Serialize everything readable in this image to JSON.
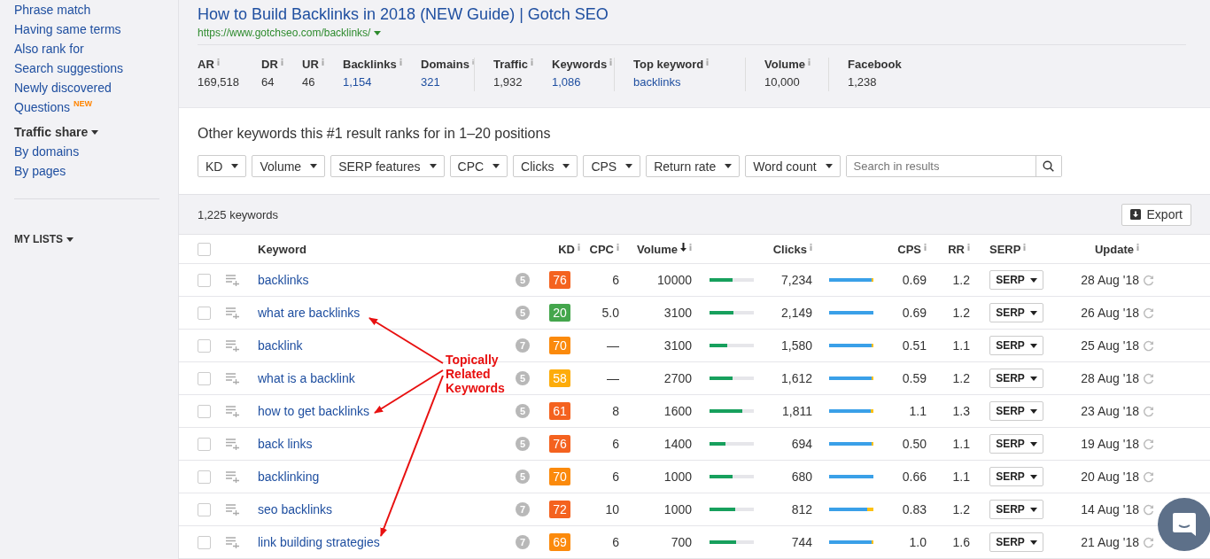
{
  "sidebar": {
    "items": [
      {
        "label": "Phrase match",
        "kind": "link"
      },
      {
        "label": "Having same terms",
        "kind": "link"
      },
      {
        "label": "Also rank for",
        "kind": "link"
      },
      {
        "label": "Search suggestions",
        "kind": "link"
      },
      {
        "label": "Newly discovered",
        "kind": "link"
      },
      {
        "label": "Questions",
        "kind": "link",
        "badge": "NEW"
      },
      {
        "label": "Traffic share",
        "kind": "heading"
      },
      {
        "label": "By domains",
        "kind": "link"
      },
      {
        "label": "By pages",
        "kind": "link"
      },
      {
        "label": "MY LISTS",
        "kind": "section"
      }
    ]
  },
  "page": {
    "title": "How to Build Backlinks in 2018 (NEW Guide) | Gotch SEO",
    "url": "https://www.gotchseo.com/backlinks/",
    "stat_groups": [
      [
        {
          "label": "AR",
          "info": true,
          "value": "169,518",
          "linked": false
        },
        {
          "label": "DR",
          "info": true,
          "value": "64",
          "linked": false
        },
        {
          "label": "UR",
          "info": true,
          "value": "46",
          "linked": false
        },
        {
          "label": "Backlinks",
          "info": true,
          "value": "1,154",
          "linked": true
        },
        {
          "label": "Domains",
          "info": true,
          "value": "321",
          "linked": true
        }
      ],
      [
        {
          "label": "Traffic",
          "info": true,
          "value": "1,932",
          "linked": false
        },
        {
          "label": "Keywords",
          "info": true,
          "value": "1,086",
          "linked": true
        }
      ],
      [
        {
          "label": "Top keyword",
          "info": true,
          "value": "backlinks",
          "linked": true
        }
      ],
      [
        {
          "label": "Volume",
          "info": true,
          "value": "10,000",
          "linked": false
        }
      ],
      [
        {
          "label": "Facebook",
          "info": false,
          "value": "1,238",
          "linked": false
        }
      ]
    ]
  },
  "keywords_panel": {
    "heading": "Other keywords this #1 result ranks for in 1–20 positions",
    "filters": [
      {
        "label": "KD"
      },
      {
        "label": "Volume"
      },
      {
        "label": "SERP features"
      },
      {
        "label": "CPC"
      },
      {
        "label": "Clicks"
      },
      {
        "label": "CPS"
      },
      {
        "label": "Return rate"
      },
      {
        "label": "Word count"
      }
    ],
    "search": {
      "placeholder": "Search in results"
    }
  },
  "results": {
    "count": "1,225 keywords",
    "export": "Export"
  },
  "table": {
    "select_all": {
      "checked": false
    },
    "columns": [
      {
        "label": "Keyword",
        "info": false,
        "sorted": false
      },
      {
        "label": "KD",
        "info": true,
        "sorted": false
      },
      {
        "label": "CPC",
        "info": true,
        "sorted": false
      },
      {
        "label": "Volume",
        "info": true,
        "sorted": true
      },
      {
        "label": "Clicks",
        "info": true,
        "sorted": false
      },
      {
        "label": "CPS",
        "info": true,
        "sorted": false
      },
      {
        "label": "RR",
        "info": true,
        "sorted": false
      },
      {
        "label": "SERP",
        "info": true,
        "sorted": false
      },
      {
        "label": "Update",
        "info": true,
        "sorted": false
      }
    ],
    "rows": [
      {
        "checked": false,
        "keyword": "backlinks",
        "serp_features": "5",
        "kd": "76",
        "color": "#f4621f",
        "cpc": "6",
        "volume": "10000",
        "volume_bar": {
          "level": 0.52
        },
        "clicks": "7,234",
        "clicks_bar": {
          "level": 0.96
        },
        "cps": "0.69",
        "rr": "1.2",
        "serp_button": "SERP",
        "updated": "28 Aug '18"
      },
      {
        "checked": false,
        "keyword": "what are backlinks",
        "serp_features": "5",
        "kd": "20",
        "color": "#44a64c",
        "cpc": "5.0",
        "volume": "3100",
        "volume_bar": {
          "level": 0.54
        },
        "clicks": "2,149",
        "clicks_bar": {
          "level": 1.0
        },
        "cps": "0.69",
        "rr": "1.2",
        "serp_button": "SERP",
        "updated": "26 Aug '18"
      },
      {
        "checked": false,
        "keyword": "backlink",
        "serp_features": "7",
        "kd": "70",
        "color": "#fb8a0c",
        "cpc": "—",
        "volume": "3100",
        "volume_bar": {
          "level": 0.4
        },
        "clicks": "1,580",
        "clicks_bar": {
          "level": 0.96
        },
        "cps": "0.51",
        "rr": "1.1",
        "serp_button": "SERP",
        "updated": "25 Aug '18"
      },
      {
        "checked": false,
        "keyword": "what is a backlink",
        "serp_features": "5",
        "kd": "58",
        "color": "#fdac0a",
        "cpc": "—",
        "volume": "2700",
        "volume_bar": {
          "level": 0.52
        },
        "clicks": "1,612",
        "clicks_bar": {
          "level": 0.96
        },
        "cps": "0.59",
        "rr": "1.2",
        "serp_button": "SERP",
        "updated": "28 Aug '18"
      },
      {
        "checked": false,
        "keyword": "how to get backlinks",
        "serp_features": "5",
        "kd": "61",
        "color": "#f4621f",
        "cpc": "8",
        "volume": "1600",
        "volume_bar": {
          "level": 0.74
        },
        "clicks": "1,811",
        "clicks_bar": {
          "level": 0.93
        },
        "cps": "1.1",
        "rr": "1.3",
        "serp_button": "SERP",
        "updated": "23 Aug '18"
      },
      {
        "checked": false,
        "keyword": "back links",
        "serp_features": "5",
        "kd": "76",
        "color": "#f4621f",
        "cpc": "6",
        "volume": "1400",
        "volume_bar": {
          "level": 0.36
        },
        "clicks": "694",
        "clicks_bar": {
          "level": 0.96
        },
        "cps": "0.50",
        "rr": "1.1",
        "serp_button": "SERP",
        "updated": "19 Aug '18"
      },
      {
        "checked": false,
        "keyword": "backlinking",
        "serp_features": "5",
        "kd": "70",
        "color": "#fb8a0c",
        "cpc": "6",
        "volume": "1000",
        "volume_bar": {
          "level": 0.52
        },
        "clicks": "680",
        "clicks_bar": {
          "level": 1.0
        },
        "cps": "0.66",
        "rr": "1.1",
        "serp_button": "SERP",
        "updated": "20 Aug '18"
      },
      {
        "checked": false,
        "keyword": "seo backlinks",
        "serp_features": "7",
        "kd": "72",
        "color": "#f4621f",
        "cpc": "10",
        "volume": "1000",
        "volume_bar": {
          "level": 0.58
        },
        "clicks": "812",
        "clicks_bar": {
          "level": 0.85
        },
        "cps": "0.83",
        "rr": "1.2",
        "serp_button": "SERP",
        "updated": "14 Aug '18"
      },
      {
        "checked": false,
        "keyword": "link building strategies",
        "serp_features": "7",
        "kd": "69",
        "color": "#fb8a0c",
        "cpc": "6",
        "volume": "700",
        "volume_bar": {
          "level": 0.6
        },
        "clicks": "744",
        "clicks_bar": {
          "level": 0.96
        },
        "cps": "1.0",
        "rr": "1.6",
        "serp_button": "SERP",
        "updated": "21 Aug '18"
      }
    ]
  },
  "annotation": {
    "text": "Topically Related Keywords"
  }
}
